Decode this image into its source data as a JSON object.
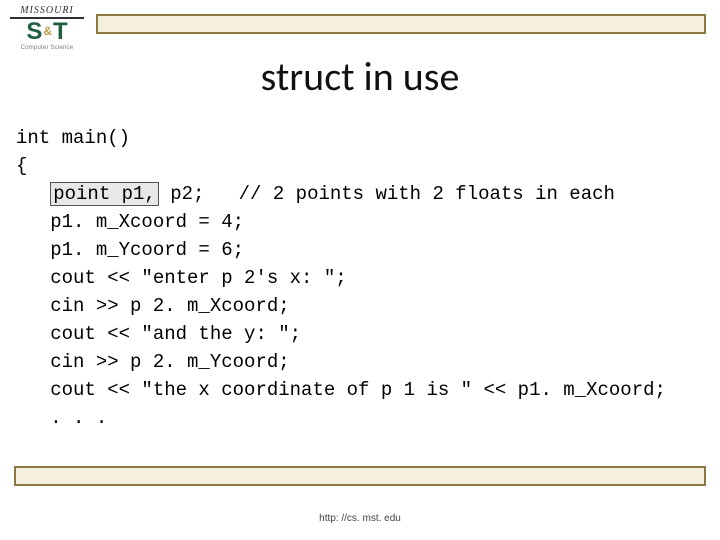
{
  "logo": {
    "top": "MISSOURI",
    "s": "S",
    "amp": "&",
    "t": "T",
    "bottom": "Computer Science"
  },
  "title": "struct in use",
  "code": {
    "l1a": "int main()",
    "l1b": "{",
    "l2_pre": "   ",
    "l2_hl": "point p1,",
    "l2_post": " p2;   // 2 points with 2 floats in each",
    "l3": "   p1. m_Xcoord = 4;",
    "l4": "   p1. m_Ycoord = 6;",
    "l5": "   cout << \"enter p 2's x: \";",
    "l6": "   cin >> p 2. m_Xcoord;",
    "l7": "   cout << \"and the y: \";",
    "l8": "   cin >> p 2. m_Ycoord;",
    "l9": "   cout << \"the x coordinate of p 1 is \" << p1. m_Xcoord;",
    "l10": "   . . ."
  },
  "footer": "http: //cs. mst. edu"
}
